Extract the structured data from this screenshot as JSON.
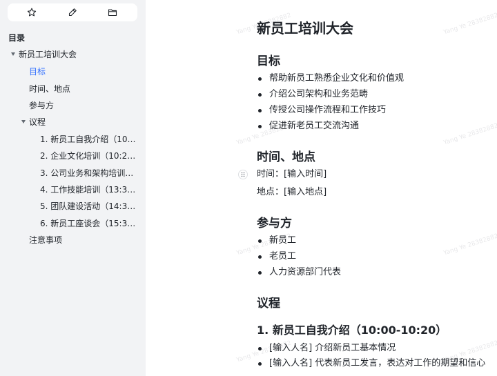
{
  "toolbar": {
    "icons": [
      "star-icon",
      "edit-icon",
      "folder-icon"
    ]
  },
  "toc": {
    "heading": "目录",
    "items": [
      "新员工培训大会",
      "目标",
      "时间、地点",
      "参与方",
      "议程",
      "1. 新员工自我介绍（10:00...",
      "2. 企业文化培训（10:20-1...",
      "3. 公司业务和架构培训（1...",
      "4. 工作技能培训（13:30-1...",
      "5. 团队建设活动（14:30-1...",
      "6. 新员工座谈会（15:30-1...",
      "注意事项"
    ]
  },
  "doc": {
    "title": "新员工培训大会",
    "goal_heading": "目标",
    "goals": [
      "帮助新员工熟悉企业文化和价值观",
      "介绍公司架构和业务范畴",
      "传授公司操作流程和工作技巧",
      "促进新老员工交流沟通"
    ],
    "time_heading": "时间、地点",
    "time_line": "时间：[输入时间]",
    "place_line": "地点：[输入地点]",
    "parties_heading": "参与方",
    "parties": [
      "新员工",
      "老员工",
      "人力资源部门代表"
    ],
    "agenda_heading": "议程",
    "agenda_item1_heading": "1. 新员工自我介绍（10:00-10:20）",
    "agenda_item1_bullets": [
      "[输入人名] 介绍新员工基本情况",
      "[输入人名] 代表新员工发言，表达对工作的期望和信心"
    ]
  },
  "watermark": "Yang Ye 28382882"
}
